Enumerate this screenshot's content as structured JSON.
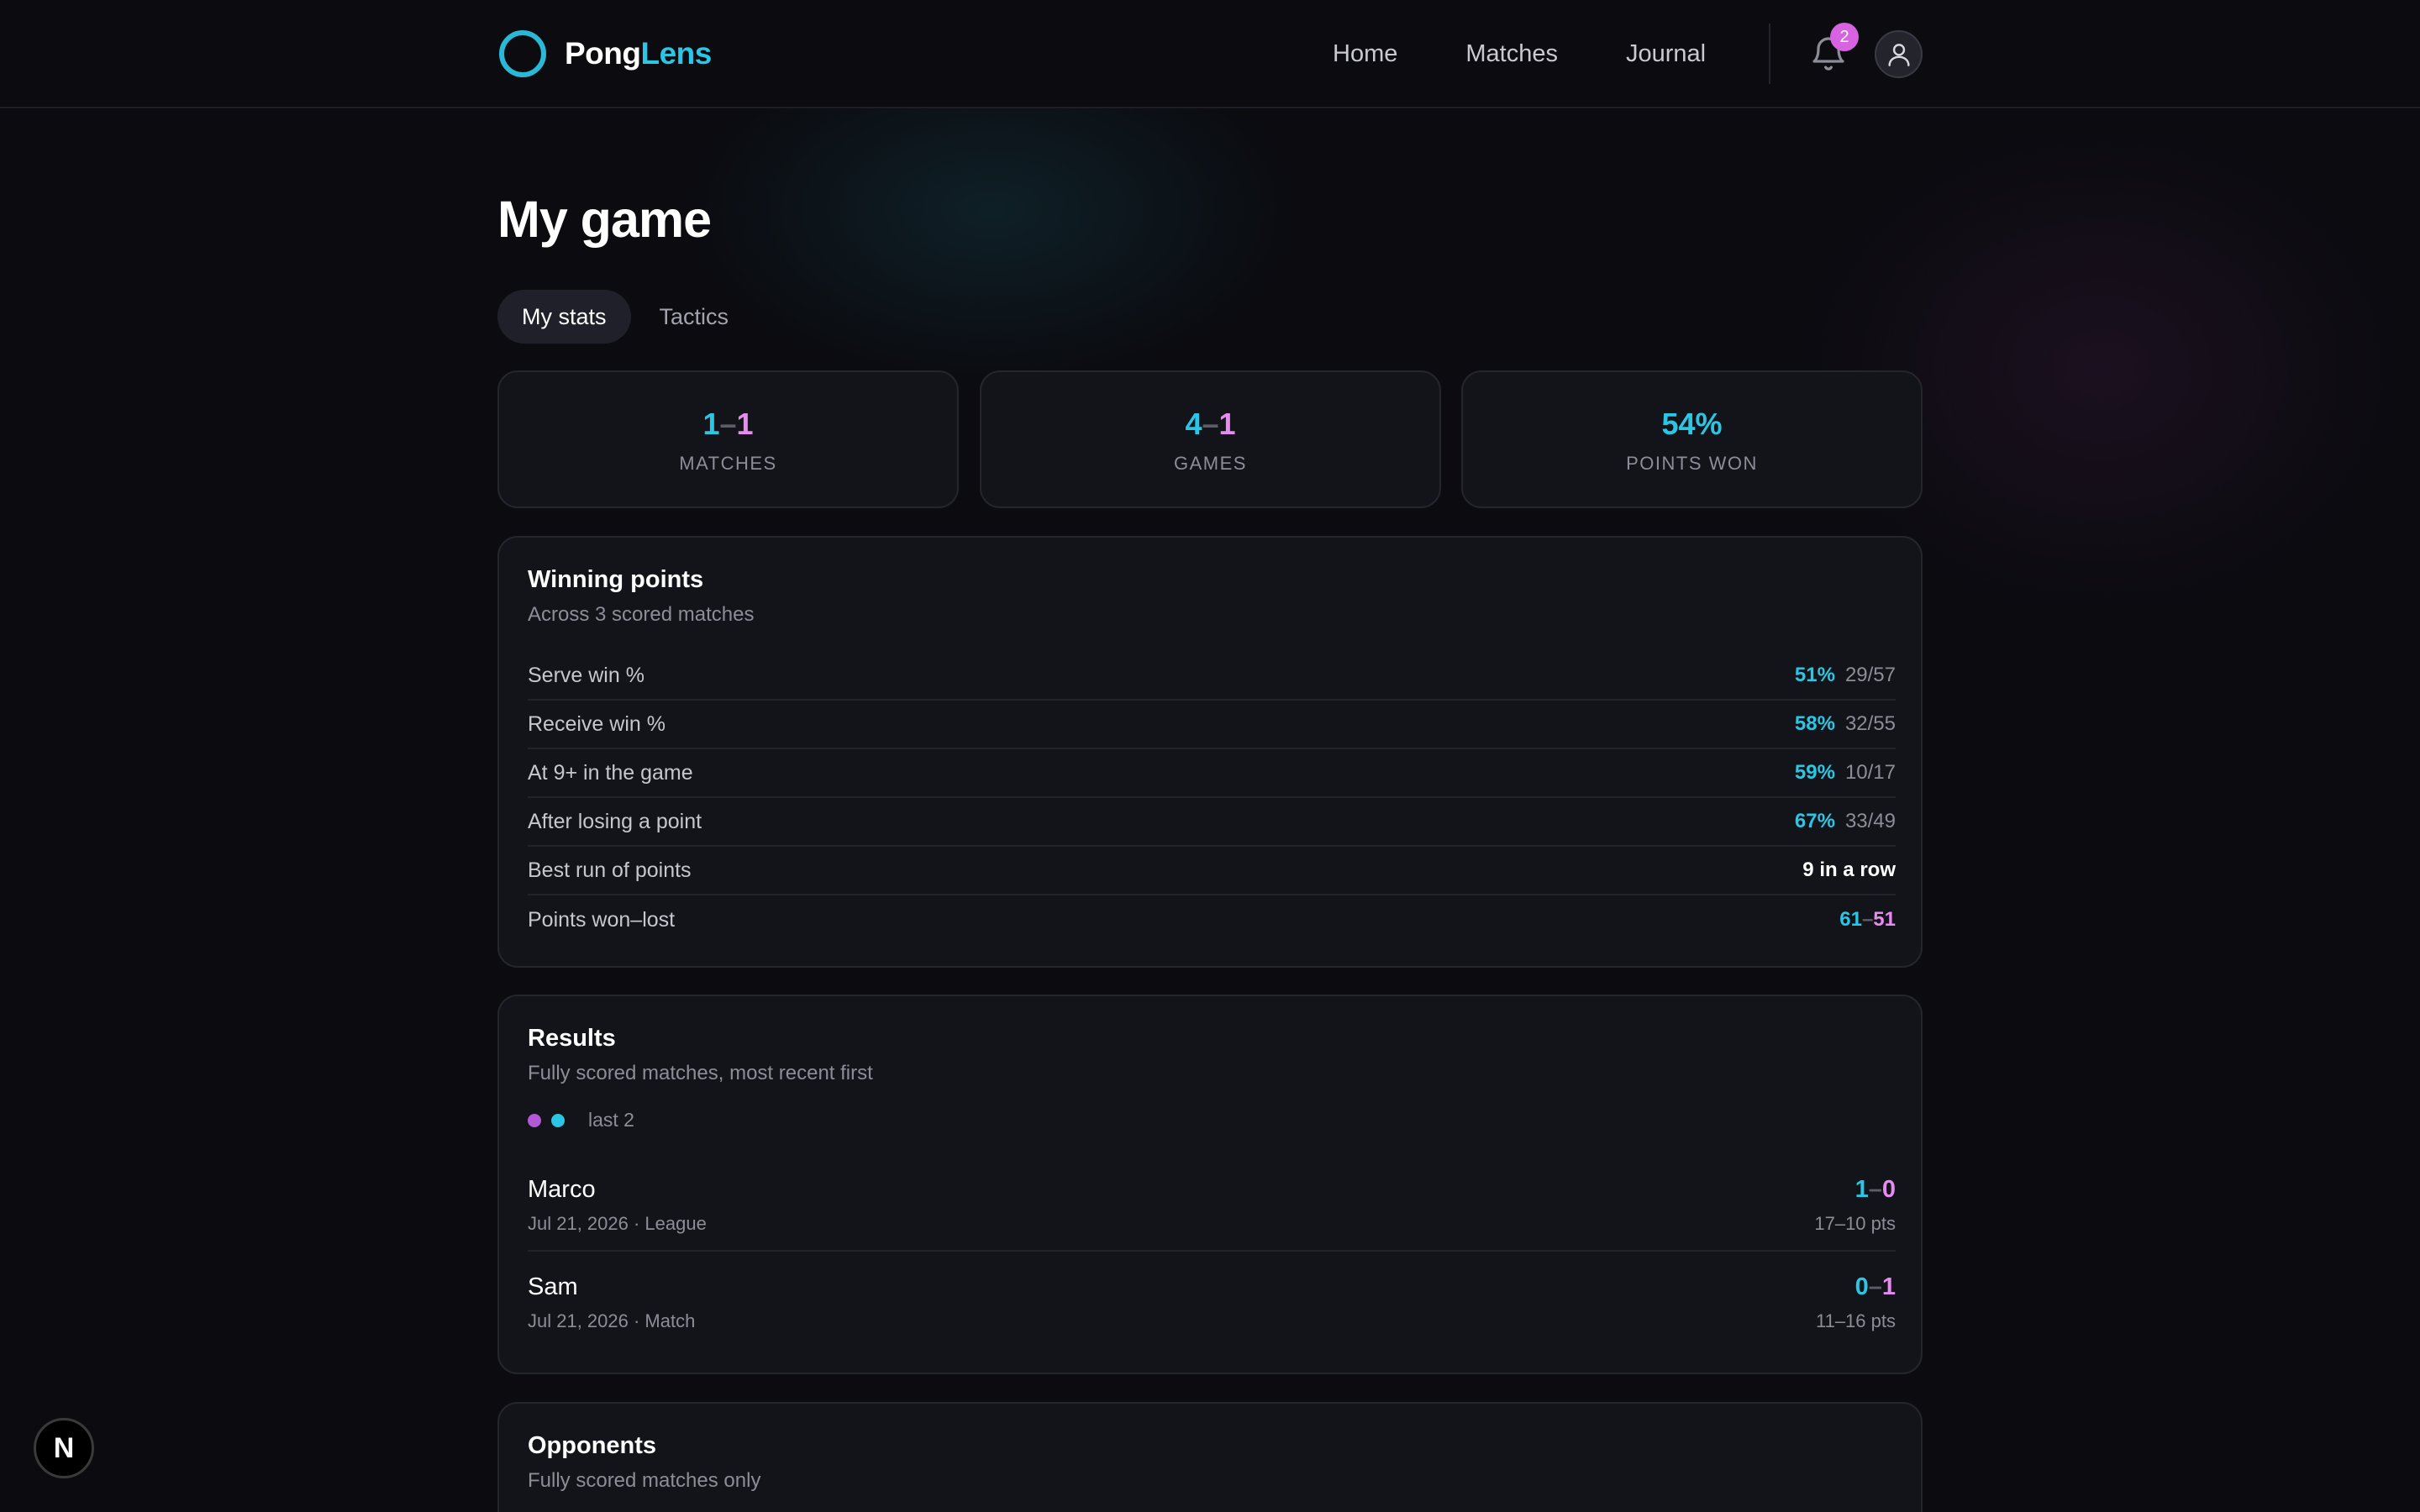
{
  "brand": {
    "part1": "Pong",
    "part2": "Lens"
  },
  "nav": {
    "home": "Home",
    "matches": "Matches",
    "journal": "Journal"
  },
  "notifications": {
    "count": "2"
  },
  "page": {
    "title": "My game"
  },
  "tabs": [
    {
      "label": "My stats",
      "active": true
    },
    {
      "label": "Tactics",
      "active": false
    }
  ],
  "summary": [
    {
      "left": "1",
      "sep": "–",
      "right": "1",
      "label": "MATCHES"
    },
    {
      "left": "4",
      "sep": "–",
      "right": "1",
      "label": "GAMES"
    },
    {
      "value": "54%",
      "label": "POINTS WON"
    }
  ],
  "winning_points": {
    "title": "Winning points",
    "subtitle": "Across 3 scored matches",
    "rows": [
      {
        "label": "Serve win %",
        "pct": "51%",
        "frac": "29/57"
      },
      {
        "label": "Receive win %",
        "pct": "58%",
        "frac": "32/55"
      },
      {
        "label": "At 9+ in the game",
        "pct": "59%",
        "frac": "10/17"
      },
      {
        "label": "After losing a point",
        "pct": "67%",
        "frac": "33/49"
      },
      {
        "label": "Best run of points",
        "value": "9 in a row"
      },
      {
        "label": "Points won–lost",
        "won": "61",
        "sep": "–",
        "lost": "51"
      }
    ]
  },
  "results": {
    "title": "Results",
    "subtitle": "Fully scored matches, most recent first",
    "legend": "last 2",
    "colors": {
      "loss": "#b25ad6",
      "win": "#2bc6e3"
    },
    "matches": [
      {
        "opponent": "Marco",
        "meta": "Jul 21, 2026 · League",
        "left": "1",
        "sep": "–",
        "right": "0",
        "pts": "17–10 pts"
      },
      {
        "opponent": "Sam",
        "meta": "Jul 21, 2026 · Match",
        "left": "0",
        "sep": "–",
        "right": "1",
        "pts": "11–16 pts"
      }
    ]
  },
  "opponents": {
    "title": "Opponents",
    "subtitle": "Fully scored matches only"
  },
  "dev_badge": {
    "letter": "N"
  }
}
